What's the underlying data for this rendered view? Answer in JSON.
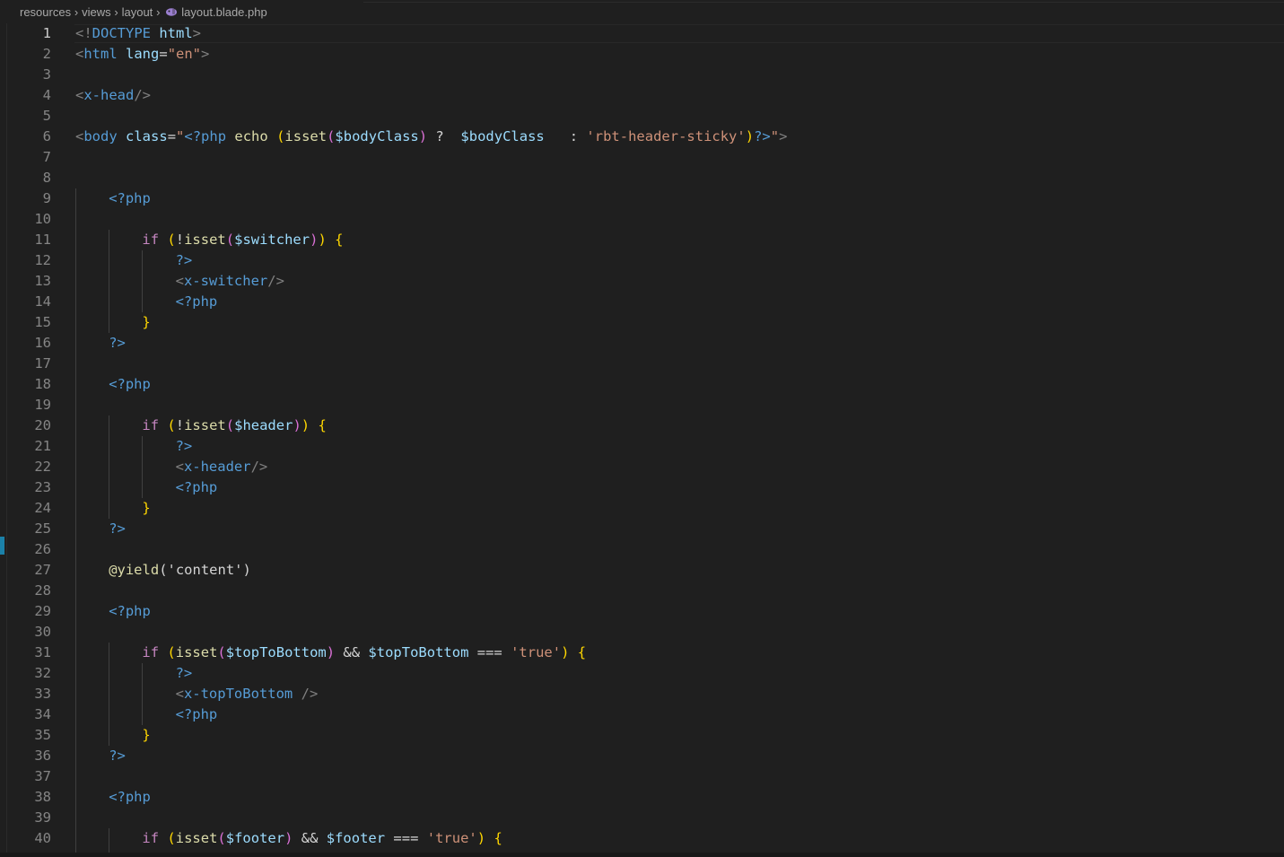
{
  "breadcrumb": {
    "items": [
      "resources",
      "views",
      "layout",
      "layout.blade.php"
    ],
    "separator": ">"
  },
  "editor": {
    "active_line": 1,
    "lines": [
      {
        "n": "1",
        "i": 0,
        "t": [
          [
            "t",
            "<!"
          ],
          [
            "n",
            "DOCTYPE"
          ],
          [
            "w",
            " "
          ],
          [
            "a",
            "html"
          ],
          [
            "t",
            ">"
          ]
        ]
      },
      {
        "n": "2",
        "i": 0,
        "t": [
          [
            "t",
            "<"
          ],
          [
            "n",
            "html"
          ],
          [
            "w",
            " "
          ],
          [
            "a",
            "lang"
          ],
          [
            "w",
            "="
          ],
          [
            "s",
            "\"en\""
          ],
          [
            "t",
            ">"
          ]
        ]
      },
      {
        "n": "3",
        "i": 0,
        "t": []
      },
      {
        "n": "4",
        "i": 0,
        "t": [
          [
            "t",
            "<"
          ],
          [
            "n",
            "x-head"
          ],
          [
            "t",
            "/>"
          ]
        ]
      },
      {
        "n": "5",
        "i": 0,
        "t": []
      },
      {
        "n": "6",
        "i": 0,
        "t": [
          [
            "t",
            "<"
          ],
          [
            "n",
            "body"
          ],
          [
            "w",
            " "
          ],
          [
            "a",
            "class"
          ],
          [
            "w",
            "="
          ],
          [
            "s",
            "\""
          ],
          [
            "p",
            "<?php"
          ],
          [
            "w",
            " "
          ],
          [
            "f",
            "echo"
          ],
          [
            "w",
            " "
          ],
          [
            "b1",
            "("
          ],
          [
            "f",
            "isset"
          ],
          [
            "b2",
            "("
          ],
          [
            "v",
            "$bodyClass"
          ],
          [
            "b2",
            ")"
          ],
          [
            "w",
            " ?  "
          ],
          [
            "v",
            "$bodyClass"
          ],
          [
            "w",
            "   : "
          ],
          [
            "s",
            "'rbt-header-sticky'"
          ],
          [
            "b1",
            ")"
          ],
          [
            "p",
            "?>"
          ],
          [
            "s",
            "\""
          ],
          [
            "t",
            ">"
          ]
        ]
      },
      {
        "n": "7",
        "i": 0,
        "t": []
      },
      {
        "n": "8",
        "i": 0,
        "t": []
      },
      {
        "n": "9",
        "i": 1,
        "t": [
          [
            "p",
            "<?php"
          ]
        ]
      },
      {
        "n": "10",
        "i": 0,
        "t": []
      },
      {
        "n": "11",
        "i": 2,
        "t": [
          [
            "k",
            "if"
          ],
          [
            "w",
            " "
          ],
          [
            "b1",
            "("
          ],
          [
            "w",
            "!"
          ],
          [
            "f",
            "isset"
          ],
          [
            "b2",
            "("
          ],
          [
            "v",
            "$switcher"
          ],
          [
            "b2",
            ")"
          ],
          [
            "b1",
            ")"
          ],
          [
            "w",
            " "
          ],
          [
            "b1",
            "{"
          ]
        ]
      },
      {
        "n": "12",
        "i": 3,
        "t": [
          [
            "p",
            "?>"
          ]
        ]
      },
      {
        "n": "13",
        "i": 3,
        "t": [
          [
            "t",
            "<"
          ],
          [
            "n",
            "x-switcher"
          ],
          [
            "t",
            "/>"
          ]
        ]
      },
      {
        "n": "14",
        "i": 3,
        "t": [
          [
            "p",
            "<?php"
          ]
        ]
      },
      {
        "n": "15",
        "i": 2,
        "t": [
          [
            "b1",
            "}"
          ]
        ]
      },
      {
        "n": "16",
        "i": 1,
        "t": [
          [
            "p",
            "?>"
          ]
        ]
      },
      {
        "n": "17",
        "i": 0,
        "t": []
      },
      {
        "n": "18",
        "i": 1,
        "t": [
          [
            "p",
            "<?php"
          ]
        ]
      },
      {
        "n": "19",
        "i": 0,
        "t": []
      },
      {
        "n": "20",
        "i": 2,
        "t": [
          [
            "k",
            "if"
          ],
          [
            "w",
            " "
          ],
          [
            "b1",
            "("
          ],
          [
            "w",
            "!"
          ],
          [
            "f",
            "isset"
          ],
          [
            "b2",
            "("
          ],
          [
            "v",
            "$header"
          ],
          [
            "b2",
            ")"
          ],
          [
            "b1",
            ")"
          ],
          [
            "w",
            " "
          ],
          [
            "b1",
            "{"
          ]
        ]
      },
      {
        "n": "21",
        "i": 3,
        "t": [
          [
            "p",
            "?>"
          ]
        ]
      },
      {
        "n": "22",
        "i": 3,
        "t": [
          [
            "t",
            "<"
          ],
          [
            "n",
            "x-header"
          ],
          [
            "t",
            "/>"
          ]
        ]
      },
      {
        "n": "23",
        "i": 3,
        "t": [
          [
            "p",
            "<?php"
          ]
        ]
      },
      {
        "n": "24",
        "i": 2,
        "t": [
          [
            "b1",
            "}"
          ]
        ]
      },
      {
        "n": "25",
        "i": 1,
        "t": [
          [
            "p",
            "?>"
          ]
        ]
      },
      {
        "n": "26",
        "i": 0,
        "t": []
      },
      {
        "n": "27",
        "i": 1,
        "t": [
          [
            "f",
            "@yield"
          ],
          [
            "w",
            "('content')"
          ]
        ]
      },
      {
        "n": "28",
        "i": 0,
        "t": []
      },
      {
        "n": "29",
        "i": 1,
        "t": [
          [
            "p",
            "<?php"
          ]
        ]
      },
      {
        "n": "30",
        "i": 0,
        "t": []
      },
      {
        "n": "31",
        "i": 2,
        "t": [
          [
            "k",
            "if"
          ],
          [
            "w",
            " "
          ],
          [
            "b1",
            "("
          ],
          [
            "f",
            "isset"
          ],
          [
            "b2",
            "("
          ],
          [
            "v",
            "$topToBottom"
          ],
          [
            "b2",
            ")"
          ],
          [
            "w",
            " && "
          ],
          [
            "v",
            "$topToBottom"
          ],
          [
            "w",
            " === "
          ],
          [
            "s",
            "'true'"
          ],
          [
            "b1",
            ")"
          ],
          [
            "w",
            " "
          ],
          [
            "b1",
            "{"
          ]
        ]
      },
      {
        "n": "32",
        "i": 3,
        "t": [
          [
            "p",
            "?>"
          ]
        ]
      },
      {
        "n": "33",
        "i": 3,
        "t": [
          [
            "t",
            "<"
          ],
          [
            "n",
            "x-topToBottom"
          ],
          [
            "w",
            " "
          ],
          [
            "t",
            "/>"
          ]
        ]
      },
      {
        "n": "34",
        "i": 3,
        "t": [
          [
            "p",
            "<?php"
          ]
        ]
      },
      {
        "n": "35",
        "i": 2,
        "t": [
          [
            "b1",
            "}"
          ]
        ]
      },
      {
        "n": "36",
        "i": 1,
        "t": [
          [
            "p",
            "?>"
          ]
        ]
      },
      {
        "n": "37",
        "i": 0,
        "t": []
      },
      {
        "n": "38",
        "i": 1,
        "t": [
          [
            "p",
            "<?php"
          ]
        ]
      },
      {
        "n": "39",
        "i": 0,
        "t": []
      },
      {
        "n": "40",
        "i": 2,
        "t": [
          [
            "k",
            "if"
          ],
          [
            "w",
            " "
          ],
          [
            "b1",
            "("
          ],
          [
            "f",
            "isset"
          ],
          [
            "b2",
            "("
          ],
          [
            "v",
            "$footer"
          ],
          [
            "b2",
            ")"
          ],
          [
            "w",
            " && "
          ],
          [
            "v",
            "$footer"
          ],
          [
            "w",
            " === "
          ],
          [
            "s",
            "'true'"
          ],
          [
            "b1",
            ")"
          ],
          [
            "w",
            " "
          ],
          [
            "b1",
            "{"
          ]
        ]
      }
    ]
  }
}
